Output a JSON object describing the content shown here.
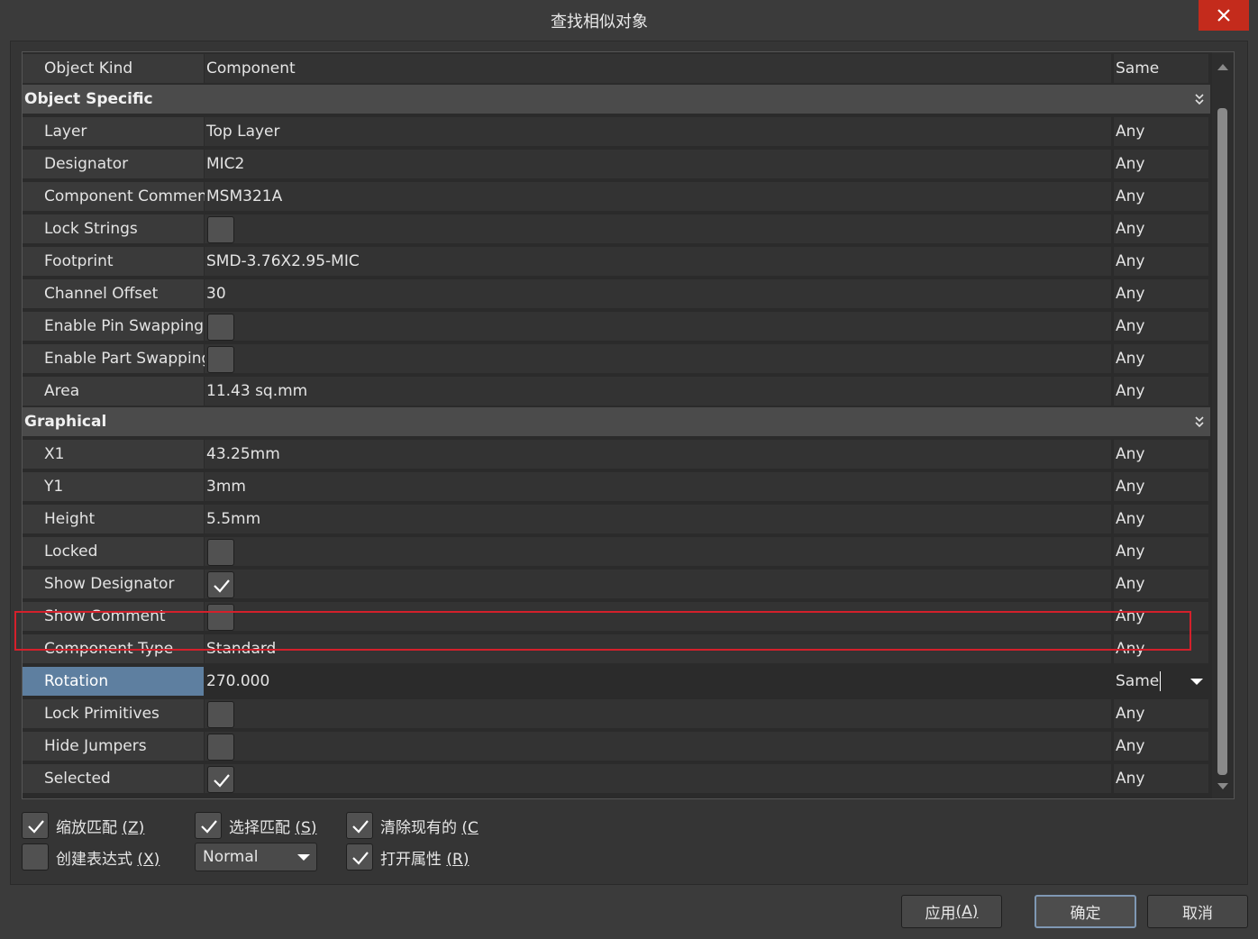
{
  "window": {
    "title": "查找相似对象"
  },
  "header_row": {
    "label": "Object Kind",
    "value": "Component",
    "match": "Same"
  },
  "sections": {
    "object_specific": "Object Specific",
    "graphical": "Graphical"
  },
  "object_specific": [
    {
      "label": "Layer",
      "value": "Top Layer",
      "match": "Any"
    },
    {
      "label": "Designator",
      "value": "MIC2",
      "match": "Any"
    },
    {
      "label": "Component Comment",
      "value": "MSM321A",
      "match": "Any"
    },
    {
      "label": "Lock Strings",
      "checked": false,
      "match": "Any"
    },
    {
      "label": "Footprint",
      "value": "SMD-3.76X2.95-MIC",
      "match": "Any"
    },
    {
      "label": "Channel Offset",
      "value": "30",
      "match": "Any"
    },
    {
      "label": "Enable Pin Swapping",
      "checked": false,
      "match": "Any"
    },
    {
      "label": "Enable Part Swapping",
      "checked": false,
      "match": "Any"
    },
    {
      "label": "Area",
      "value": "11.43 sq.mm",
      "match": "Any"
    }
  ],
  "graphical": [
    {
      "label": "X1",
      "value": "43.25mm",
      "match": "Any"
    },
    {
      "label": "Y1",
      "value": "3mm",
      "match": "Any"
    },
    {
      "label": "Height",
      "value": "5.5mm",
      "match": "Any"
    },
    {
      "label": "Locked",
      "checked": false,
      "match": "Any"
    },
    {
      "label": "Show Designator",
      "checked": true,
      "match": "Any"
    },
    {
      "label": "Show Comment",
      "checked": false,
      "match": "Any"
    },
    {
      "label": "Component Type",
      "value": "Standard",
      "match": "Any"
    },
    {
      "label": "Rotation",
      "value": "270.000",
      "match": "Same",
      "selected": true
    },
    {
      "label": "Lock Primitives",
      "checked": false,
      "match": "Any"
    },
    {
      "label": "Hide Jumpers",
      "checked": false,
      "match": "Any"
    },
    {
      "label": "Selected",
      "checked": true,
      "match": "Any"
    }
  ],
  "options": {
    "zoom": {
      "text": "缩放匹配 ",
      "key": "(Z)",
      "checked": true
    },
    "select": {
      "text": "选择匹配 ",
      "key": "(S)",
      "checked": true
    },
    "clear": {
      "text": "清除现有的 ",
      "key": "(C",
      "checked": true
    },
    "expression": {
      "text": "创建表达式 ",
      "key": "(X)",
      "checked": false
    },
    "open_props": {
      "text": "打开属性 ",
      "key": "(R)",
      "checked": true
    },
    "mask_mode": "Normal"
  },
  "buttons": {
    "apply": {
      "text": "应用 ",
      "key": "(A)"
    },
    "ok": "确定",
    "cancel": "取消"
  }
}
